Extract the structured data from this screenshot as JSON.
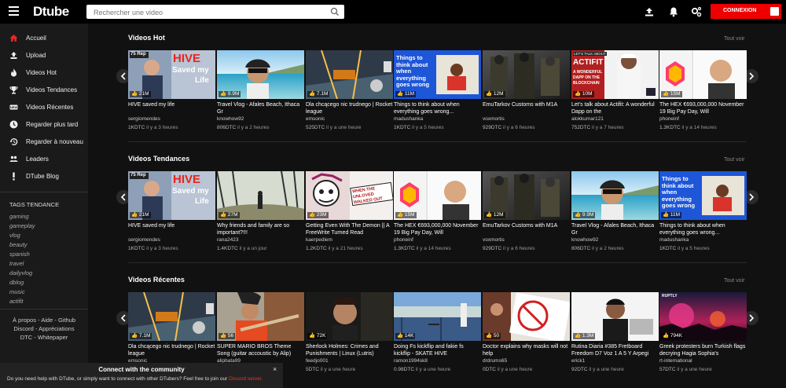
{
  "header": {
    "logo": "Dtube",
    "search_placeholder": "Rechercher une video",
    "login_label": "CONNEXION"
  },
  "sidebar": {
    "items": [
      {
        "label": "Accueil",
        "icon": "home-icon"
      },
      {
        "label": "Upload",
        "icon": "upload-icon"
      },
      {
        "label": "Videos Hot",
        "icon": "fire-icon"
      },
      {
        "label": "Videos Tendances",
        "icon": "trophy-icon"
      },
      {
        "label": "Videos Récentes",
        "icon": "new-icon"
      },
      {
        "label": "Regarder plus tard",
        "icon": "clock-icon"
      },
      {
        "label": "Regarder à nouveau",
        "icon": "history-icon"
      },
      {
        "label": "Leaders",
        "icon": "people-icon"
      },
      {
        "label": "DTube Blog",
        "icon": "exclamation-icon"
      }
    ],
    "tags_title": "TAGS TENDANCE",
    "tags": [
      "gaming",
      "gameplay",
      "vlog",
      "beauty",
      "spanish",
      "travel",
      "dailyvlog",
      "dblog",
      "music",
      "actifit"
    ],
    "footer": {
      "l1": [
        "À propos",
        "Aide",
        "Github"
      ],
      "l2": [
        "Discord",
        "Appréciations"
      ],
      "l3": [
        "DTC",
        "Whitepaper"
      ],
      "sep": "-"
    }
  },
  "sections": [
    {
      "title": "Videos Hot",
      "see_all": "Tout voir",
      "cards": [
        {
          "badge": "21M",
          "title": "HIVE saved my life",
          "author": "sergiomendes",
          "value": "1KDTC",
          "age": "il y a 3 heures"
        },
        {
          "badge": "9.9M",
          "title": "Travel Vlog - Afales Beach, Ithaca Gr",
          "author": "knowhow92",
          "value": "806DTC",
          "age": "il y a 2 heures"
        },
        {
          "badge": "7.1M",
          "title": "Dla chcącego nic trudnego | Rocket league",
          "author": "emsonic",
          "value": "525DTC",
          "age": "il y a une heure"
        },
        {
          "badge": "11M",
          "title": "Things to think about when everything goes wrong...",
          "author": "madushanka",
          "value": "1KDTC",
          "age": "il y a 5 heures"
        },
        {
          "badge": "12M",
          "title": "EmuTarkov Customs with M1A",
          "author": "voxmortis",
          "value": "929DTC",
          "age": "il y a 6 heures"
        },
        {
          "badge": "10M",
          "title": "Let's talk about Actifit: A wonderful Dapp on the",
          "author": "alokkumar121",
          "value": "752DTC",
          "age": "il y a 7 heures"
        },
        {
          "badge": "15M",
          "title": "The HEX €693,000,000 November 19 Big Pay Day, Will",
          "author": "phoneinf",
          "value": "1.3KDTC",
          "age": "il y a 14 heures"
        }
      ]
    },
    {
      "title": "Videos Tendances",
      "see_all": "Tout voir",
      "cards": [
        {
          "badge": "21M",
          "title": "HIVE saved my life",
          "author": "sergiomendes",
          "value": "1KDTC",
          "age": "il y a 3 heures"
        },
        {
          "badge": "27M",
          "title": "Why friends and family are so important?!!!",
          "author": "rana2423",
          "value": "1.4KDTC",
          "age": "il y a un jour"
        },
        {
          "badge": "23M",
          "title": "Getting Even With The Demon || A FreeWrite Turned Read",
          "author": "kaerpediem",
          "value": "1.2KDTC",
          "age": "il y a 21 heures"
        },
        {
          "badge": "15M",
          "title": "The HEX €693,000,000 November 19 Big Pay Day, Will",
          "author": "phoneinf",
          "value": "1.3KDTC",
          "age": "il y a 14 heures"
        },
        {
          "badge": "12M",
          "title": "EmuTarkov Customs with M1A",
          "author": "voxmortis",
          "value": "929DTC",
          "age": "il y a 6 heures"
        },
        {
          "badge": "9.9M",
          "title": "Travel Vlog - Afales Beach, Ithaca Gr",
          "author": "knowhow92",
          "value": "806DTC",
          "age": "il y a 2 heures"
        },
        {
          "badge": "11M",
          "title": "Things to think about when everything goes wrong...",
          "author": "madushanka",
          "value": "1KDTC",
          "age": "il y a 5 heures"
        }
      ]
    },
    {
      "title": "Videos Récentes",
      "see_all": "Tout voir",
      "cards": [
        {
          "badge": "7.1M",
          "title": "Dla chcącego nic trudnego | Rocket league",
          "author": "emsonic",
          "value": "",
          "age": ""
        },
        {
          "badge": "56",
          "title": "SUPER MARIO BROS Theme Song (guitar accoustic by Alip)",
          "author": "alipbata99",
          "value": "",
          "age": ""
        },
        {
          "badge": "72K",
          "title": "Sherlock Holmes: Crimes and Punishments | Linux (Lutris)",
          "author": "feedjo001",
          "value": "5DTC",
          "age": "il y a une heure"
        },
        {
          "badge": "14K",
          "title": "Doing Fs kickflip and fakie fs kickflip - SKATE HIVE",
          "author": "ramon1994sk8",
          "value": "0.98DTC",
          "age": "il y a une heure"
        },
        {
          "badge": "50",
          "title": "Doctor explains why masks will not help",
          "author": "drdrums65",
          "value": "0DTC",
          "age": "il y a une heure"
        },
        {
          "badge": "1.3M",
          "title": "Rutina Diaria #385 Fretboard Freedom D7 Voz 1 A 5 Y Arpegi",
          "author": "erick1",
          "value": "92DTC",
          "age": "il y a une heure"
        },
        {
          "badge": "794K",
          "title": "Greek protesters burn Turkish flags decrying Hagia Sophia's",
          "author": "rt-international",
          "value": "57DTC",
          "age": "il y a une heure"
        }
      ]
    }
  ],
  "thumb_text": {
    "hive": "HIVE",
    "saved": "Saved my",
    "life": "Life",
    "rep": "75 Rep",
    "things": "Things to think about when everything goes wrong",
    "actifit_tag": "LET'S TALK ABOUT",
    "actifit": "ACTIFIT",
    "actifit_sub": "A WONDERFUL DAPP ON THE BLOCKCHAIN",
    "demon": "WHEN THE UNLOVED WALKED OUT",
    "rptly": "RUPTLY"
  },
  "toast": {
    "title": "Connect with the community",
    "body": "Do you need help with DTube, or simply want to connect with other DTubers? Feel free to join our",
    "link": "Discord server.",
    "close": "×"
  },
  "colors": {
    "accent": "#e00000",
    "bg": "#111111",
    "sidebar": "#1a1a1a"
  }
}
